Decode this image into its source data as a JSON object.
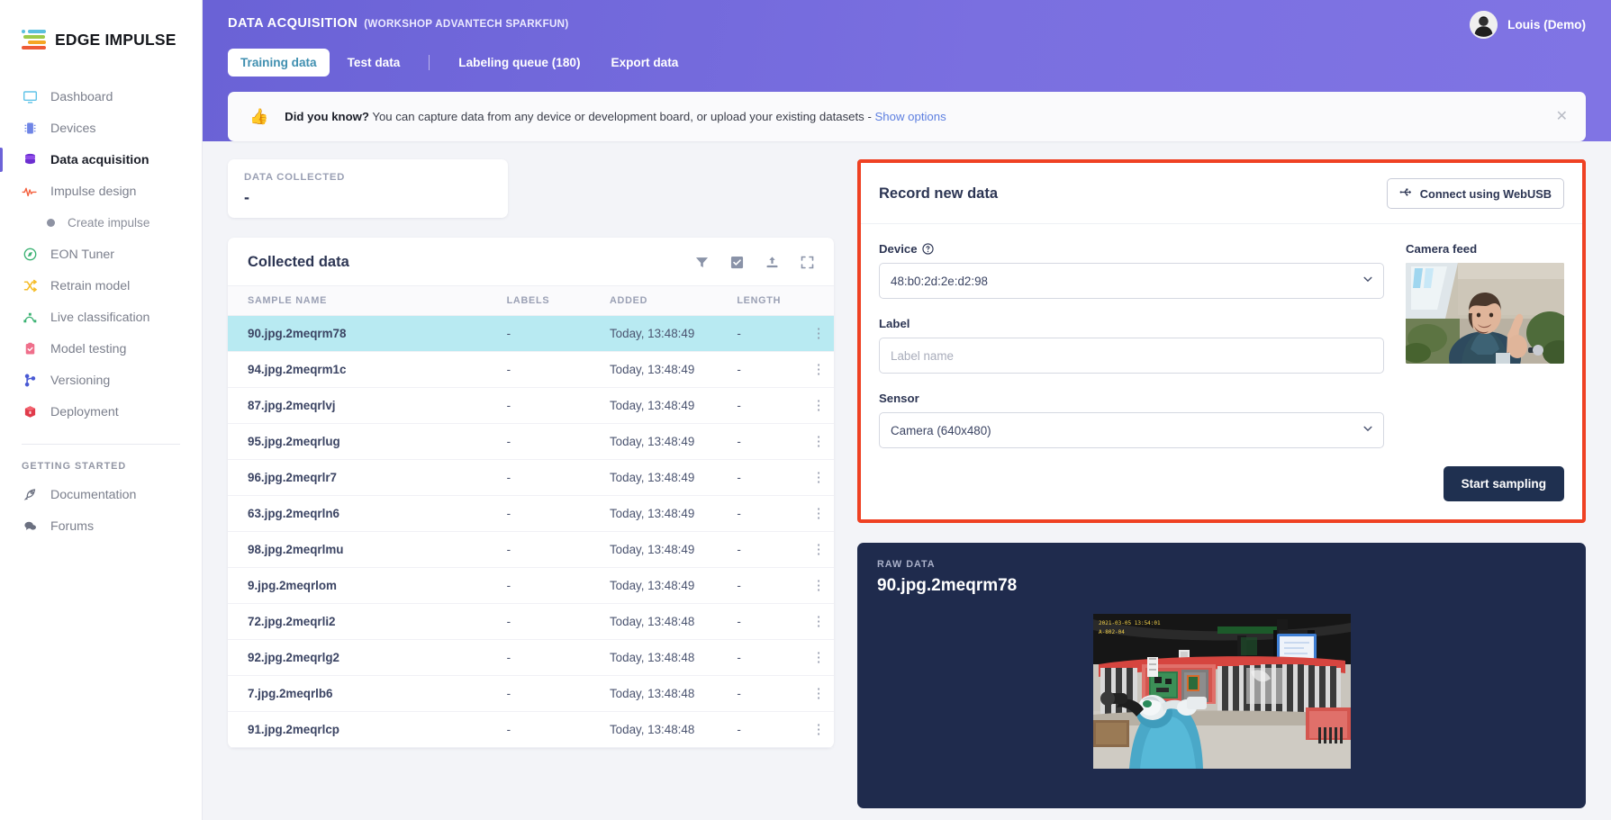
{
  "brand": {
    "name": "EDGE IMPULSE",
    "logo_icon": "edge-impulse-logo"
  },
  "sidebar": {
    "items": [
      {
        "label": "Dashboard",
        "icon": "monitor-icon",
        "color": "#62c4e8",
        "active": false
      },
      {
        "label": "Devices",
        "icon": "chip-icon",
        "color": "#5d7fe0",
        "active": false
      },
      {
        "label": "Data acquisition",
        "icon": "database-icon",
        "color": "#6c2fd0",
        "active": true
      },
      {
        "label": "Impulse design",
        "icon": "pulse-icon",
        "color": "#f4603e",
        "active": false
      }
    ],
    "sub_items": [
      {
        "label": "Create impulse",
        "icon": "dot-icon"
      }
    ],
    "items2": [
      {
        "label": "EON Tuner",
        "icon": "compass-icon",
        "color": "#3bb273"
      },
      {
        "label": "Retrain model",
        "icon": "shuffle-icon",
        "color": "#f5bd2b"
      },
      {
        "label": "Live classification",
        "icon": "graph-icon",
        "color": "#3bb273"
      },
      {
        "label": "Model testing",
        "icon": "clipboard-check-icon",
        "color": "#ef6f8b"
      },
      {
        "label": "Versioning",
        "icon": "branch-icon",
        "color": "#4a5ad4"
      },
      {
        "label": "Deployment",
        "icon": "box-icon",
        "color": "#e03b4b"
      }
    ],
    "section_header": "GETTING STARTED",
    "footer_items": [
      {
        "label": "Documentation",
        "icon": "rocket-icon",
        "color": "#6b7080"
      },
      {
        "label": "Forums",
        "icon": "chat-icon",
        "color": "#6b7080"
      }
    ]
  },
  "header": {
    "title": "DATA ACQUISITION",
    "subtitle": "(WORKSHOP ADVANTECH SPARKFUN)",
    "user_name": "Louis (Demo)",
    "avatar_icon": "user-avatar",
    "tabs": [
      {
        "label": "Training data",
        "active": true
      },
      {
        "label": "Test data",
        "active": false
      },
      {
        "label": "Labeling queue (180)",
        "active": false
      },
      {
        "label": "Export data",
        "active": false
      }
    ],
    "banner": {
      "icon": "thumbs-up-icon",
      "bold": "Did you know?",
      "text": " You can capture data from any device or development board, or upload your existing datasets - ",
      "link": "Show options",
      "close_icon": "close-icon"
    }
  },
  "stat": {
    "label": "DATA COLLECTED",
    "value": "-"
  },
  "collected": {
    "title": "Collected data",
    "tools": [
      {
        "icon": "filter-icon"
      },
      {
        "icon": "checkbox-icon"
      },
      {
        "icon": "upload-icon"
      },
      {
        "icon": "fullscreen-icon"
      }
    ],
    "columns": [
      "SAMPLE NAME",
      "LABELS",
      "ADDED",
      "LENGTH"
    ],
    "rows": [
      {
        "name": "90.jpg.2meqrm78",
        "labels": "-",
        "added": "Today, 13:48:49",
        "length": "-",
        "selected": true
      },
      {
        "name": "94.jpg.2meqrm1c",
        "labels": "-",
        "added": "Today, 13:48:49",
        "length": "-",
        "selected": false
      },
      {
        "name": "87.jpg.2meqrlvj",
        "labels": "-",
        "added": "Today, 13:48:49",
        "length": "-",
        "selected": false
      },
      {
        "name": "95.jpg.2meqrlug",
        "labels": "-",
        "added": "Today, 13:48:49",
        "length": "-",
        "selected": false
      },
      {
        "name": "96.jpg.2meqrlr7",
        "labels": "-",
        "added": "Today, 13:48:49",
        "length": "-",
        "selected": false
      },
      {
        "name": "63.jpg.2meqrln6",
        "labels": "-",
        "added": "Today, 13:48:49",
        "length": "-",
        "selected": false
      },
      {
        "name": "98.jpg.2meqrlmu",
        "labels": "-",
        "added": "Today, 13:48:49",
        "length": "-",
        "selected": false
      },
      {
        "name": "9.jpg.2meqrlom",
        "labels": "-",
        "added": "Today, 13:48:49",
        "length": "-",
        "selected": false
      },
      {
        "name": "72.jpg.2meqrli2",
        "labels": "-",
        "added": "Today, 13:48:48",
        "length": "-",
        "selected": false
      },
      {
        "name": "92.jpg.2meqrlg2",
        "labels": "-",
        "added": "Today, 13:48:48",
        "length": "-",
        "selected": false
      },
      {
        "name": "7.jpg.2meqrlb6",
        "labels": "-",
        "added": "Today, 13:48:48",
        "length": "-",
        "selected": false
      },
      {
        "name": "91.jpg.2meqrlcp",
        "labels": "-",
        "added": "Today, 13:48:48",
        "length": "-",
        "selected": false
      }
    ],
    "row_menu_icon": "kebab-menu-icon"
  },
  "record": {
    "title": "Record new data",
    "webusb_label": "Connect using WebUSB",
    "webusb_icon": "usb-icon",
    "device_label": "Device",
    "device_help_icon": "help-circle-icon",
    "device_value": "48:b0:2d:2e:d2:98",
    "label_label": "Label",
    "label_placeholder": "Label name",
    "label_value": "",
    "sensor_label": "Sensor",
    "sensor_value": "Camera (640x480)",
    "camera_label": "Camera feed",
    "start_label": "Start sampling",
    "highlight_color": "#ef4123"
  },
  "raw": {
    "label": "RAW DATA",
    "title": "90.jpg.2meqrm78",
    "image_icon": "factory-line-photo"
  }
}
